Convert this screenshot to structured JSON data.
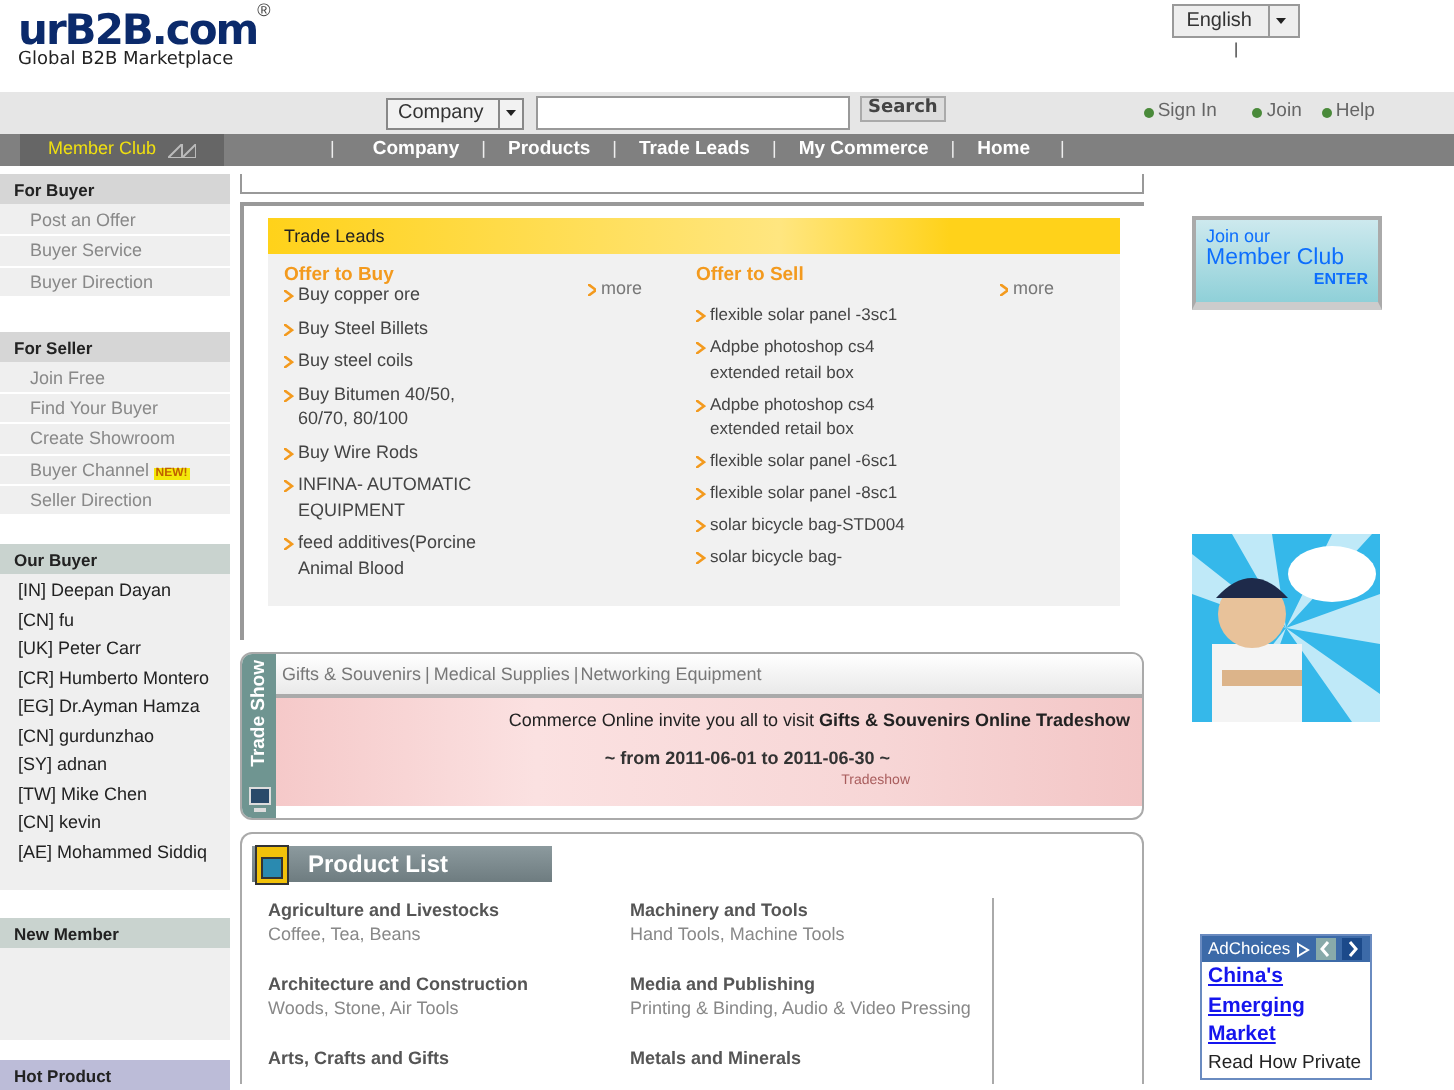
{
  "header": {
    "logo": {
      "name": "urB2B.com",
      "registered": "®",
      "tagline": "Global B2B Marketplace"
    },
    "language": "English",
    "divider": "|"
  },
  "search": {
    "category": "Company",
    "button": "Search",
    "links": [
      "Sign In",
      "Join",
      "Help"
    ]
  },
  "nav": {
    "member_club": "Member Club",
    "separator": "|",
    "items": [
      "Company",
      "Products",
      "Trade Leads",
      "My Commerce",
      "Home"
    ]
  },
  "sidebar": [
    {
      "title": "For Buyer",
      "kind": "menu",
      "items": [
        {
          "label": "Post an Offer"
        },
        {
          "label": "Buyer Service"
        },
        {
          "label": "Buyer Direction"
        }
      ]
    },
    {
      "title": "For Seller",
      "kind": "menu",
      "items": [
        {
          "label": "Join Free"
        },
        {
          "label": "Find Your Buyer"
        },
        {
          "label": "Create Showroom"
        },
        {
          "label": "Buyer Channel",
          "badge": "NEW!"
        },
        {
          "label": "Seller Direction"
        }
      ]
    },
    {
      "title": "Our Buyer",
      "kind": "list",
      "items": [
        {
          "label": "[IN] Deepan Dayan"
        },
        {
          "label": "[CN] fu"
        },
        {
          "label": "[UK] Peter Carr"
        },
        {
          "label": "[CR] Humberto Montero"
        },
        {
          "label": "[EG] Dr.Ayman Hamza"
        },
        {
          "label": "[CN] gurdunzhao"
        },
        {
          "label": "[SY] adnan"
        },
        {
          "label": "[TW] Mike Chen"
        },
        {
          "label": "[CN] kevin"
        },
        {
          "label": "[AE] Mohammed Siddiq"
        }
      ]
    },
    {
      "title": "New Member",
      "kind": "list"
    },
    {
      "title": "Hot Product",
      "kind": "promo"
    }
  ],
  "trade_leads": {
    "title": "Trade Leads",
    "columns": [
      {
        "title": "Offer to Buy",
        "more": "more",
        "items": [
          "Buy copper ore",
          "Buy Steel Billets",
          "Buy steel coils",
          "Buy Bitumen 40/50, 60/70, 80/100",
          "Buy Wire Rods",
          "INFINA- AUTOMATIC EQUIPMENT",
          "feed additives(Porcine Animal Blood"
        ]
      },
      {
        "title": "Offer to Sell",
        "more": "more",
        "items": [
          "flexible solar panel -3sc1",
          "Adpbe photoshop cs4 extended retail box",
          "Adpbe photoshop cs4 extended retail box",
          "flexible solar panel -6sc1",
          "flexible solar panel -8sc1",
          "solar bicycle bag-STD004",
          "solar bicycle bag-"
        ]
      }
    ]
  },
  "trade_show": {
    "label": "Trade Show",
    "categories": [
      "Gifts & Souvenirs",
      "Medical Supplies",
      "Networking Equipment"
    ],
    "separator": "|",
    "invite": "Commerce Online invite you all to visit  **Gifts & Souvenirs Online Tradeshow**",
    "dates": "~ from 2011-06-01 to 2011-06-30 ~",
    "caption": "Tradeshow"
  },
  "product_list": {
    "title": "Product List",
    "columns": [
      [
        {
          "name": "Agriculture and Livestocks",
          "subs": "Coffee, Tea, Beans"
        },
        {
          "name": "Architecture and Construction",
          "subs": "Woods, Stone, Air Tools"
        },
        {
          "name": "Arts, Crafts and Gifts"
        }
      ],
      [
        {
          "name": "Machinery and Tools",
          "subs": "Hand Tools, Machine Tools"
        },
        {
          "name": "Media and Publishing",
          "subs": "Printing & Binding, Audio & Video Pressing"
        },
        {
          "name": "Metals and Minerals"
        }
      ]
    ]
  },
  "right": {
    "member_banner": {
      "line1": "Join our",
      "line2": "Member Club",
      "enter": "ENTER"
    },
    "ad": {
      "label": "AdChoices",
      "headline": "China's Emerging Market",
      "body": "Read How Private"
    }
  }
}
